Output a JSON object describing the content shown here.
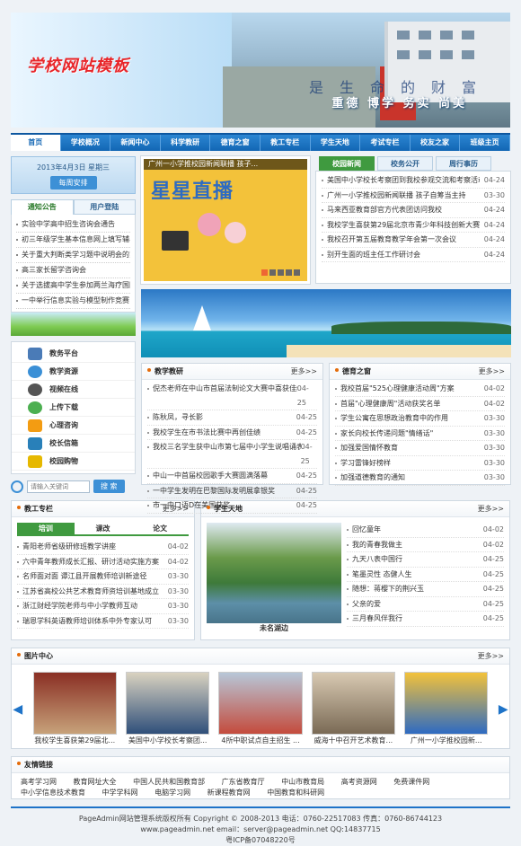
{
  "banner": {
    "logo": "学校网站模板",
    "motto": "重德  博学  务实  尚美",
    "wall_text": "是生命的财富"
  },
  "nav": [
    "首页",
    "学校概况",
    "新闻中心",
    "科学教研",
    "德育之窗",
    "教工专栏",
    "学生天地",
    "考试专栏",
    "校友之家",
    "班级主页"
  ],
  "date": {
    "text": "2013年4月3日 星期三",
    "btn": "每周安排"
  },
  "notice_tabs": [
    "通知公告",
    "用户登陆"
  ],
  "notices": [
    "实验中学高中招生咨询会通告",
    "初三年级学生基本信息网上填写辅导",
    "关于重大判断类学习题中说明会的紧急",
    "高三家长留学咨询会",
    "关于选拔高中学生参加两兰海疗国际模",
    "一中举行信息实验与模型制作竞赛"
  ],
  "menu": [
    {
      "label": "教务平台",
      "icon": "books-icon",
      "color": "#4a7bb7"
    },
    {
      "label": "教学资源",
      "icon": "globe-icon",
      "color": "#3a8fd6"
    },
    {
      "label": "视频在线",
      "icon": "film-icon",
      "color": "#555555"
    },
    {
      "label": "上传下载",
      "icon": "upload-icon",
      "color": "#4caf50"
    },
    {
      "label": "心理咨询",
      "icon": "rss-icon",
      "color": "#f39c12"
    },
    {
      "label": "校长信箱",
      "icon": "mail-icon",
      "color": "#2980b9"
    },
    {
      "label": "校园购物",
      "icon": "bag-icon",
      "color": "#e6b800"
    }
  ],
  "search": {
    "placeholder": "请输入关键词",
    "btn": "搜  索"
  },
  "slide": {
    "caption": "广州一小学推校园新闻联播 孩子...",
    "star": "星星直播"
  },
  "news_tabs": [
    "校园新闻",
    "校务公开",
    "周行事历"
  ],
  "news": [
    {
      "t": "美国中小学校长考察团到我校参观交流和考察活动",
      "d": "04-24"
    },
    {
      "t": "广州一小学推校园新闻联播 孩子自筹当主持",
      "d": "03-30"
    },
    {
      "t": "马来西亚教育部官方代表团访问我校",
      "d": "04-24"
    },
    {
      "t": "我校学生喜获第29届北京市青少年科技创新大赛优秀成绩",
      "d": "04-24"
    },
    {
      "t": "我校召开第五届教育教学年会第一次会议",
      "d": "04-24"
    },
    {
      "t": "别开生面的班主任工作研讨会",
      "d": "04-24"
    }
  ],
  "teach": {
    "title": "教学教研",
    "more": "更多>>",
    "items": [
      {
        "t": "倪杰老师在中山市首届法制论文大赛中喜获佳绩",
        "d": "04-25"
      },
      {
        "t": "陈秋凤，寻长影",
        "d": "04-25"
      },
      {
        "t": "我校学生在市书法比赛中再创佳绩",
        "d": "04-25"
      },
      {
        "t": "我校三名学生获中山市第七届中小学生说唱诵表比赛一等奖",
        "d": "04-25"
      },
      {
        "t": "中山一中首届校园歌手大赛圆满落幕",
        "d": "04-25"
      },
      {
        "t": "一中学生发明在巴黎国际发明展拿银奖",
        "d": "04-25"
      },
      {
        "t": "市一中口语D在美国获奖",
        "d": "04-25"
      }
    ]
  },
  "moral": {
    "title": "德育之窗",
    "more": "更多>>",
    "items": [
      {
        "t": "我校首届\"525心理健康活动周\"方案",
        "d": "04-02"
      },
      {
        "t": "首届\"心理健康周\"活动获奖名单",
        "d": "04-02"
      },
      {
        "t": "学生公寓在思想政治教育中的作用",
        "d": "03-30"
      },
      {
        "t": "家长向校长传递问题\"情绪话\"",
        "d": "03-30"
      },
      {
        "t": "加强爱国情怀教育",
        "d": "03-30"
      },
      {
        "t": "学习雷锋好榜样",
        "d": "03-30"
      },
      {
        "t": "加强道德教育的通知",
        "d": "03-30"
      }
    ]
  },
  "staff": {
    "title": "教工专栏",
    "more": "更多>>",
    "tabs": [
      "培训",
      "课改",
      "论文"
    ],
    "items": [
      {
        "t": "青阳老师省级研修班教学讲座",
        "d": "04-02"
      },
      {
        "t": "六中青年教师成长汇报、研讨活动实施方案",
        "d": "04-02"
      },
      {
        "t": "名师面对面 谭江县开展教师培训新途径",
        "d": "03-30"
      },
      {
        "t": "江苏省高校公共艺术教育师资培训基地成立",
        "d": "03-30"
      },
      {
        "t": "浙江财经学院老师与中小学教师互动",
        "d": "03-30"
      },
      {
        "t": "瑞恩学科英语教师培训体系中外专家认可",
        "d": "03-30"
      }
    ]
  },
  "student": {
    "title": "学生天地",
    "more": "更多>>",
    "photo_caption": "未名湖边",
    "items": [
      {
        "t": "回忆童年",
        "d": "04-02"
      },
      {
        "t": "我的青春我做主",
        "d": "04-02"
      },
      {
        "t": "九天八表中国行",
        "d": "04-25"
      },
      {
        "t": "笔墨灵性 态健人生",
        "d": "04-25"
      },
      {
        "t": "随想：蒋樱下的荆兴玉",
        "d": "04-25"
      },
      {
        "t": "父亲的爱",
        "d": "04-25"
      },
      {
        "t": "三月春风伴我行",
        "d": "04-25"
      }
    ]
  },
  "gallery": {
    "title": "图片中心",
    "more": "更多>>",
    "items": [
      {
        "cap": "我校学生喜获第29届北...",
        "c1": "#8a2f24",
        "c2": "#c7a27a"
      },
      {
        "cap": "美国中小学校长考察团...",
        "c1": "#2f4f7a",
        "c2": "#d9d2c0"
      },
      {
        "cap": "4所中职试点自主招生 ...",
        "c1": "#b7c7d8",
        "c2": "#c44b3c"
      },
      {
        "cap": "威海十中召开艺术教育...",
        "c1": "#7a6a55",
        "c2": "#d8c9b2"
      },
      {
        "cap": "广州一小学推校园新...",
        "c1": "#f3c23a",
        "c2": "#2e6bc2"
      }
    ]
  },
  "friends": {
    "title": "友情链接",
    "items": [
      "高考学习网",
      "教育网址大全",
      "中国人民共和国教育部",
      "广东省教育厅",
      "中山市教育局",
      "高考资源网",
      "免费课件网",
      "中小学信息技术教育",
      "中学学科网",
      "电脑学习网",
      "新课程教育网",
      "中国教育和科研网"
    ]
  },
  "footer": [
    "PageAdmin网站管理系统版权所有  Copyright © 2008-2013     电话：0760-22517083  传真：0760-86744123",
    "www.pageadmin.net  email：server@pageadmin.net  QQ:14837715",
    "粤ICP备07048220号"
  ]
}
